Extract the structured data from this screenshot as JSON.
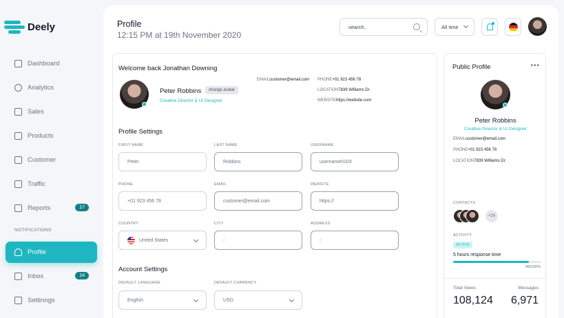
{
  "app": {
    "name": "Deely",
    "brand_color": "#1fb6c1"
  },
  "sidebar": {
    "items": [
      {
        "label": "Dashboard",
        "icon": "grid-icon"
      },
      {
        "label": "Analytics",
        "icon": "pie-chart-icon"
      },
      {
        "label": "Sales",
        "icon": "wallet-icon"
      },
      {
        "label": "Products",
        "icon": "bag-icon"
      },
      {
        "label": "Customer",
        "icon": "briefcase-icon"
      },
      {
        "label": "Traffic",
        "icon": "chart-icon"
      },
      {
        "label": "Reports",
        "icon": "document-icon",
        "badge": "17"
      },
      {
        "label": "Profile",
        "icon": "user-icon",
        "active": true
      },
      {
        "label": "Inbox",
        "icon": "inbox-icon",
        "badge": "14"
      },
      {
        "label": "Settinngs",
        "icon": "folder-icon"
      }
    ],
    "section_label": "NOTIFICATIONS"
  },
  "header": {
    "title": "Profile",
    "datetime": "12:15 PM at 19th November 2020",
    "search_text": "search..",
    "time_filter": "All time"
  },
  "welcome": {
    "greeting": "Welcome back Jonathan Downing",
    "name": "Peter Robbins",
    "change_avatar": "change avatar",
    "role": "Creative Director & UI Designer",
    "email_key": "EMAIL",
    "email": "customer@email.com",
    "phone_key": "PHONE",
    "phone": "+01 923 456 78",
    "location_key": "LOCATION",
    "location": "7839 Williams Dr.",
    "website_key": "WEBSITE",
    "website": "https://website.com"
  },
  "profile_settings": {
    "title": "Profile Settings",
    "first_name": {
      "label": "FIRST NAME",
      "value": "Peter"
    },
    "last_name": {
      "label": "LAST NAME",
      "value": "Robbins"
    },
    "username": {
      "label": "USERNAME",
      "value": "username0103"
    },
    "phone": {
      "label": "PHONE",
      "value": "+01 923 456 78"
    },
    "email": {
      "label": "EMAIL",
      "value": "customer@email.com"
    },
    "website": {
      "label": "WEBSITE",
      "value": "https://"
    },
    "country": {
      "label": "COUNTRY",
      "value": "United States"
    },
    "city": {
      "label": "CITY",
      "value": "-"
    },
    "address": {
      "label": "ADDRESS",
      "value": "-"
    }
  },
  "account_settings": {
    "title": "Account Settings",
    "language": {
      "label": "DEFAULT LANGUAGE",
      "value": "English"
    },
    "currency": {
      "label": "DEFAULT CURRENCY",
      "value": "USD"
    }
  },
  "public_profile": {
    "title": "Public Profile",
    "more": "•••",
    "name": "Peter Robbins",
    "role": "Creative Director & UI Designer",
    "email_key": "EMAIL",
    "email": "customer@email.com",
    "phone_key": "PHONE",
    "phone": "+01 923 456 78",
    "location_key": "LOCATION",
    "location": "7839 Williams Dr.",
    "contacts_label": "CONTACTS",
    "contacts_more": "+29",
    "activity_label": "ACTIVITY",
    "activity_status": "ACTIVE",
    "response_time": "5 hours response time",
    "progress_text": "86/100%",
    "progress_value": 0.86,
    "total_views_label": "Total Views",
    "total_views": "108,124",
    "messages_label": "Messages",
    "messages": "6,971"
  }
}
